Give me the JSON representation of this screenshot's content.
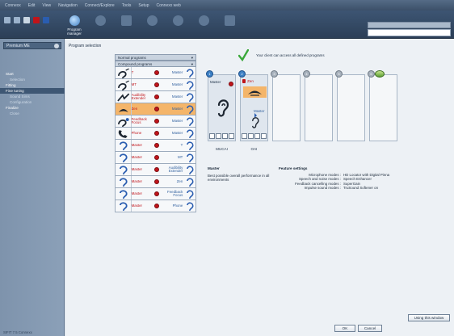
{
  "menubar": {
    "items": [
      "Connexx",
      "Edit",
      "View",
      "Navigation",
      "Connect/Explore",
      "Tools",
      "Setup",
      "Connexx web"
    ]
  },
  "toolbar": {
    "buttons": [
      {
        "label": "Program manager",
        "active": true,
        "icon": "program-manager-icon",
        "color": "#7fb7e8"
      },
      {
        "label": "",
        "active": false,
        "icon": "fitting-icon",
        "color": "#6e86a3"
      },
      {
        "label": "",
        "active": false,
        "icon": "document-icon",
        "color": "#6e86a3"
      },
      {
        "label": "",
        "active": false,
        "icon": "tools-icon",
        "color": "#6e86a3"
      },
      {
        "label": "",
        "active": false,
        "icon": "sound-icon",
        "color": "#6e86a3"
      },
      {
        "label": "",
        "active": false,
        "icon": "hearing-icon",
        "color": "#6e86a3"
      },
      {
        "label": "",
        "active": false,
        "icon": "print-icon",
        "color": "#6e86a3"
      }
    ]
  },
  "leftnav": {
    "client_name": "Premium ME",
    "items": [
      {
        "label": "Start",
        "type": "head",
        "selected": false
      },
      {
        "label": "Selection",
        "type": "sub",
        "selected": false
      },
      {
        "label": "Fitting",
        "type": "head",
        "selected": false
      },
      {
        "label": "Fine tuning",
        "type": "head",
        "selected": true
      },
      {
        "label": "Sound Sims",
        "type": "sub",
        "selected": false
      },
      {
        "label": "Configuration",
        "type": "sub",
        "selected": false
      },
      {
        "label": "Finalize",
        "type": "head",
        "selected": false
      },
      {
        "label": "Close",
        "type": "sub",
        "selected": false
      }
    ],
    "footer": "SIFIT 7.5 Connexx"
  },
  "main": {
    "section_title": "Program selection",
    "list_headers": {
      "normal": "Normal programs",
      "compound": "Compound programs"
    },
    "programs": [
      {
        "name": "T",
        "link": "Master",
        "color": "#c0141a",
        "dot": "red",
        "icon": "telecoil-icon",
        "selected": false
      },
      {
        "name": "MT",
        "link": "Master",
        "color": "#c0141a",
        "dot": "red",
        "icon": "telecoil-icon",
        "selected": false
      },
      {
        "name": "Audibility Extender",
        "link": "Master",
        "color": "#c0141a",
        "dot": "red",
        "icon": "audibility-extender-icon",
        "selected": false
      },
      {
        "name": "Zen",
        "link": "Master",
        "color": "#c0141a",
        "dot": "red",
        "icon": "zen-icon",
        "selected": true
      },
      {
        "name": "Feedback Focus",
        "link": "Master",
        "color": "#c0141a",
        "dot": "red",
        "icon": "feedback-focus-icon",
        "selected": false
      },
      {
        "name": "Phone",
        "link": "Master",
        "color": "#c0141a",
        "dot": "red",
        "icon": "phone-icon",
        "selected": false
      },
      {
        "name": "Master",
        "link": "T",
        "color": "#c0141a",
        "dot": "red",
        "icon": "master-ear-icon",
        "selected": false
      },
      {
        "name": "Master",
        "link": "MT",
        "color": "#c0141a",
        "dot": "red",
        "icon": "master-ear-icon",
        "selected": false
      },
      {
        "name": "Master",
        "link": "Audibility Extender",
        "color": "#c0141a",
        "dot": "red",
        "icon": "master-ear-icon",
        "selected": false
      },
      {
        "name": "Master",
        "link": "Zen",
        "color": "#c0141a",
        "dot": "red",
        "icon": "master-ear-icon",
        "selected": false
      },
      {
        "name": "Master",
        "link": "Feedback Focus",
        "color": "#c0141a",
        "dot": "red",
        "icon": "master-ear-icon",
        "selected": false
      },
      {
        "name": "Master",
        "link": "Phone",
        "color": "#c0141a",
        "dot": "red",
        "icon": "master-ear-icon",
        "selected": false
      }
    ],
    "add_arrow": "›",
    "status_message": "Your client can access all defined programs",
    "slots": [
      {
        "number": "1",
        "title": "Master",
        "label": "MUCAI",
        "filled": true
      },
      {
        "number": "2",
        "title": "Zen",
        "mode": "Master",
        "label": "OAI",
        "filled": true
      },
      {
        "number": "3",
        "label": "",
        "filled": false
      },
      {
        "number": "4",
        "label": "",
        "filled": false
      },
      {
        "number": "5",
        "label": "",
        "filled": false
      },
      {
        "number": "6",
        "label": "",
        "filled": false
      }
    ],
    "info": {
      "program_title": "Master",
      "program_desc": "Best possible overall performance in all environments",
      "feature_title": "Feature settings",
      "features": [
        {
          "key": "Microphone modes :",
          "value": "HD Locator with Digital Pinna"
        },
        {
          "key": "Speech and noise modes :",
          "value": "Speech Enhancer"
        },
        {
          "key": "Feedback cancelling modes :",
          "value": "SuperGain"
        },
        {
          "key": "Impulse sound modes :",
          "value": "TruSound Softener on"
        }
      ]
    },
    "help_button": "Using this window",
    "ok_button": "OK",
    "cancel_button": "Cancel"
  },
  "colors": {
    "program_red": "#c0141a",
    "link_blue": "#2f5f9e",
    "selection_orange": "#f4b56a",
    "slot_blue": "#3b7fc4",
    "check_green": "#3aa83a"
  }
}
